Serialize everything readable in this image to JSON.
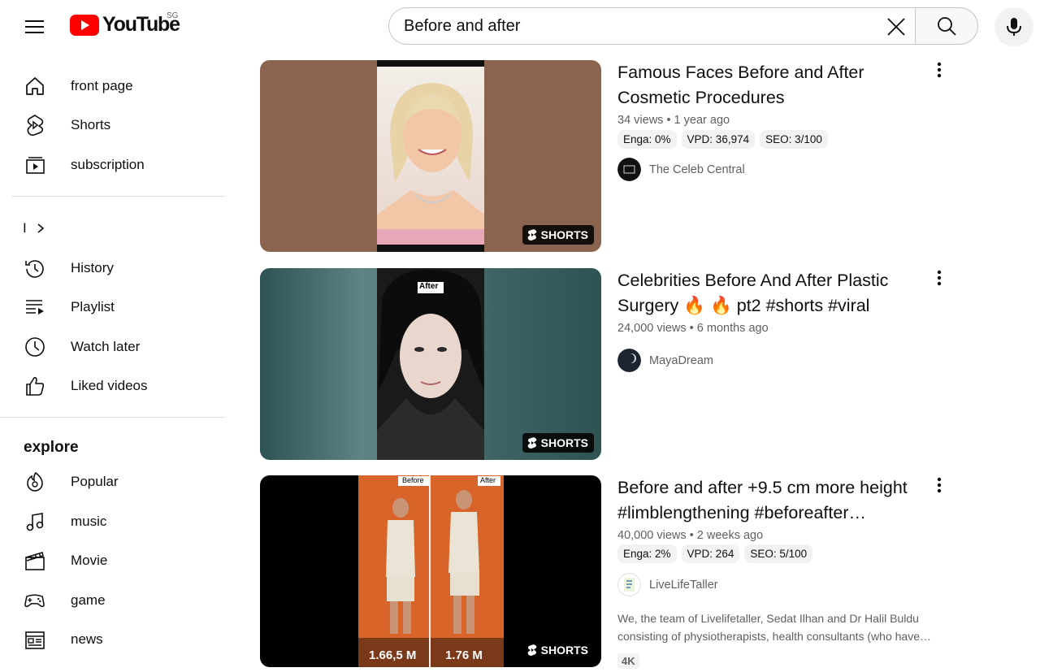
{
  "header": {
    "logo_text": "YouTube",
    "region": "SG",
    "search": {
      "value": "Before and after"
    }
  },
  "sidebar": {
    "primary": [
      {
        "label": "front page",
        "icon": "home-icon"
      },
      {
        "label": "Shorts",
        "icon": "shorts-icon"
      },
      {
        "label": "subscription",
        "icon": "subscriptions-icon"
      }
    ],
    "you_label": "I",
    "library": [
      {
        "label": "History",
        "icon": "history-icon"
      },
      {
        "label": "Playlist",
        "icon": "playlist-icon"
      },
      {
        "label": "Watch later",
        "icon": "watch-later-icon"
      },
      {
        "label": "Liked videos",
        "icon": "like-icon"
      }
    ],
    "explore_title": "explore",
    "explore": [
      {
        "label": "Popular",
        "icon": "trending-icon"
      },
      {
        "label": "music",
        "icon": "music-icon"
      },
      {
        "label": "Movie",
        "icon": "movie-icon"
      },
      {
        "label": "game",
        "icon": "gaming-icon"
      },
      {
        "label": "news",
        "icon": "news-icon"
      }
    ]
  },
  "results": [
    {
      "title": "Famous Faces Before and After Cosmetic Procedures",
      "meta": "34 views • 1 year ago",
      "chips": [
        "Enga: 0%",
        "VPD: 36,974",
        "SEO: 3/100"
      ],
      "channel": "The Celeb Central",
      "badge": "SHORTS"
    },
    {
      "title": "Celebrities Before And After Plastic Surgery 🔥 🔥 pt2 #shorts #viral",
      "meta": "24,000 views • 6 months ago",
      "channel": "MayaDream",
      "badge": "SHORTS",
      "thumb_label": "After"
    },
    {
      "title": "Before and after +9.5 cm more height #limblengthening #beforeafter…",
      "meta": "40,000 views • 2 weeks ago",
      "chips": [
        "Enga: 2%",
        "VPD: 264",
        "SEO: 5/100"
      ],
      "channel": "LiveLifeTaller",
      "description": "We, the team of Livelifetaller, Sedat Ilhan and Dr Halil Buldu consisting of physiotherapists, health consultants (who have…",
      "tag": "4K",
      "badge": "SHORTS",
      "thumb_labels": [
        "Before",
        "After"
      ],
      "thumb_heights": [
        "1.66,5 M",
        "1.76 M"
      ]
    }
  ],
  "colors": {
    "brand_red": "#ff0000",
    "text": "#0f0f0f",
    "secondary_text": "#606060",
    "chip_bg": "#f2f2f2"
  }
}
